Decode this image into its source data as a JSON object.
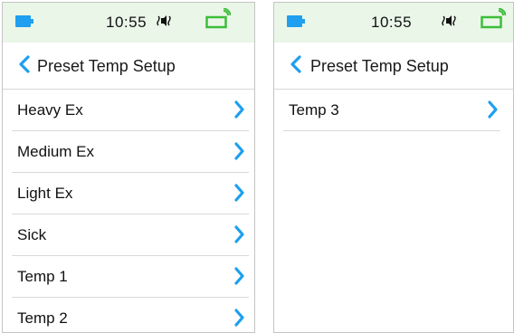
{
  "colors": {
    "status_bar_bg": "#e9f6e8",
    "accent_blue": "#1e9fef",
    "signal_green": "#3dbd3a",
    "text": "#111111",
    "divider": "#d9d9d9"
  },
  "screens": [
    {
      "status": {
        "time": "10:55",
        "battery_icon": "battery-icon",
        "sound_icon": "vibrate-sound-icon",
        "signal_icon": "signal-icon"
      },
      "header": {
        "back_icon": "chevron-left-icon",
        "title": "Preset Temp Setup"
      },
      "items": [
        {
          "label": "Heavy Ex"
        },
        {
          "label": "Medium Ex"
        },
        {
          "label": "Light Ex"
        },
        {
          "label": "Sick"
        },
        {
          "label": "Temp 1"
        },
        {
          "label": "Temp 2"
        }
      ]
    },
    {
      "status": {
        "time": "10:55",
        "battery_icon": "battery-icon",
        "sound_icon": "vibrate-sound-icon",
        "signal_icon": "signal-icon"
      },
      "header": {
        "back_icon": "chevron-left-icon",
        "title": "Preset Temp Setup"
      },
      "items": [
        {
          "label": "Temp 3"
        }
      ]
    }
  ]
}
